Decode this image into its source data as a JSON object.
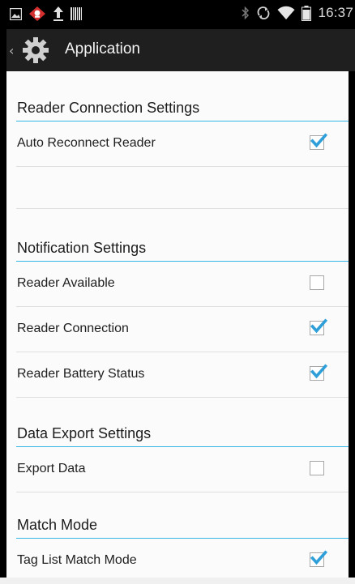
{
  "status_bar": {
    "time": "16:37",
    "left_icons": [
      "gallery-icon",
      "app-alert-icon",
      "upload-icon",
      "barcode-icon"
    ],
    "right_icons": [
      "bluetooth-icon",
      "sync-icon",
      "wifi-icon",
      "battery-icon"
    ]
  },
  "action_bar": {
    "title": "Application",
    "icon": "gear-icon",
    "up_indicator": "‹"
  },
  "sections": [
    {
      "header": "Reader Connection Settings",
      "rows": [
        {
          "label": "Auto Reconnect Reader",
          "checked": true
        }
      ]
    },
    {
      "header": "Notification Settings",
      "rows": [
        {
          "label": "Reader Available",
          "checked": false
        },
        {
          "label": "Reader Connection",
          "checked": true
        },
        {
          "label": "Reader Battery Status",
          "checked": true
        }
      ]
    },
    {
      "header": "Data Export Settings",
      "rows": [
        {
          "label": "Export Data",
          "checked": false
        }
      ]
    },
    {
      "header": "Match Mode",
      "rows": [
        {
          "label": "Tag List Match Mode",
          "checked": true
        }
      ]
    }
  ],
  "colors": {
    "accent": "#33b5e5",
    "checkmark": "#2e9fd8",
    "action_bar": "#1f1f1f",
    "status_bar": "#000000",
    "background": "#fbfbfb"
  }
}
